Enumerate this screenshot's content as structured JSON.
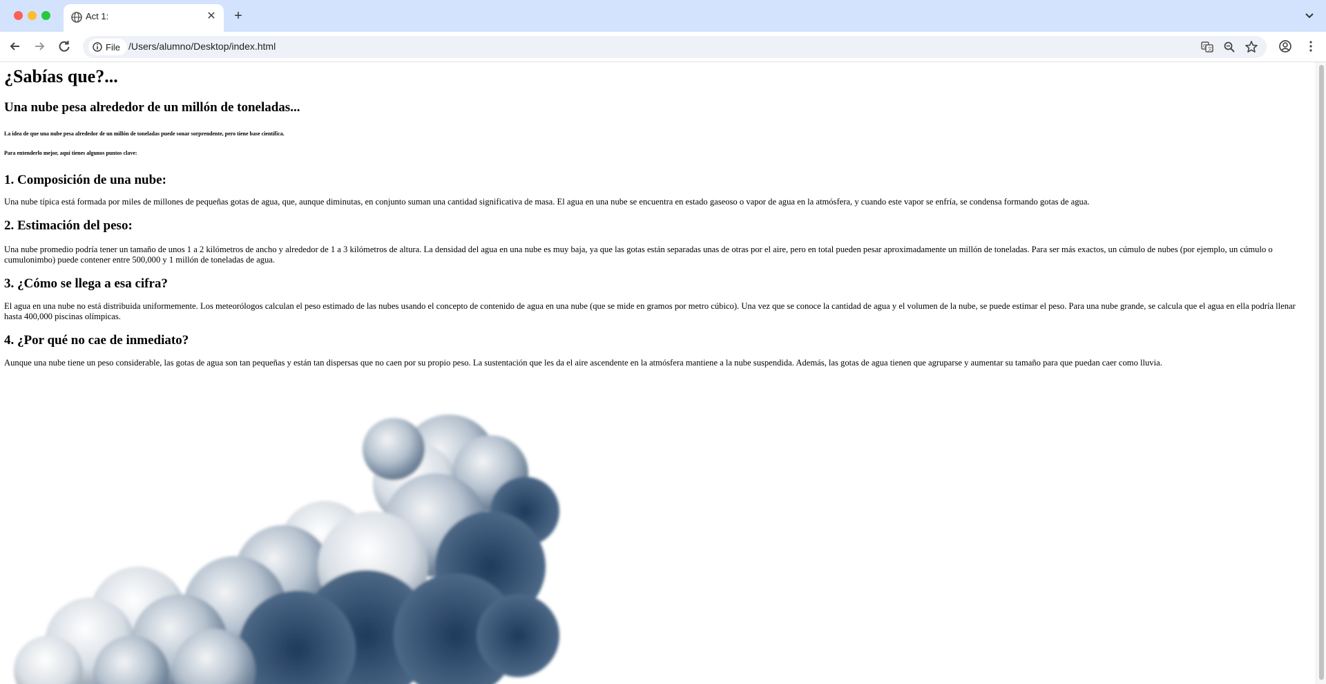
{
  "browser": {
    "tab_title": "Act 1:",
    "tab_close": "✕",
    "new_tab": "+",
    "address_chip": "File",
    "url": "/Users/alumno/Desktop/index.html"
  },
  "page": {
    "title": "¿Sabías que?...",
    "subtitle": "Una nube pesa alrededor de un millón de toneladas...",
    "intro1": "La idea de que una nube pesa alrededor de un millón de toneladas puede sonar sorprendente, pero tiene base científica.",
    "intro2": "Para entenderlo mejor, aquí tienes algunos puntos clave:",
    "sections": [
      {
        "heading": "1. Composición de una nube:",
        "text": "Una nube típica está formada por miles de millones de pequeñas gotas de agua, que, aunque diminutas, en conjunto suman una cantidad significativa de masa. El agua en una nube se encuentra en estado gaseoso o vapor de agua en la atmósfera, y cuando este vapor se enfría, se condensa formando gotas de agua."
      },
      {
        "heading": "2. Estimación del peso:",
        "text": "Una nube promedio podría tener un tamaño de unos 1 a 2 kilómetros de ancho y alrededor de 1 a 3 kilómetros de altura. La densidad del agua en una nube es muy baja, ya que las gotas están separadas unas de otras por el aire, pero en total pueden pesar aproximadamente un millón de toneladas. Para ser más exactos, un cúmulo de nubes (por ejemplo, un cúmulo o cumulonimbo) puede contener entre 500,000 y 1 millón de toneladas de agua."
      },
      {
        "heading": "3. ¿Cómo se llega a esa cifra?",
        "text": "El agua en una nube no está distribuida uniformemente. Los meteorólogos calculan el peso estimado de las nubes usando el concepto de contenido de agua en una nube (que se mide en gramos por metro cúbico). Una vez que se conoce la cantidad de agua y el volumen de la nube, se puede estimar el peso. Para una nube grande, se calcula que el agua en ella podría llenar hasta 400,000 piscinas olímpicas."
      },
      {
        "heading": "4. ¿Por qué no cae de inmediato?",
        "text": "Aunque una nube tiene un peso considerable, las gotas de agua son tan pequeñas y están tan dispersas que no caen por su propio peso. La sustentación que les da el aire ascendente en la atmósfera mantiene a la nube suspendida. Además, las gotas de agua tienen que agruparse y aumentar su tamaño para que puedan caer como lluvia."
      }
    ]
  },
  "colors": {
    "tabbar_bg": "#d3e3fd",
    "omnibox_bg": "#eef1f8",
    "cloud_dark": "#2e4a6e",
    "cloud_light": "#e7ebf0"
  },
  "icons": [
    "globe-icon",
    "close-icon",
    "plus-icon",
    "chevron-down-icon",
    "back-arrow-icon",
    "forward-arrow-icon",
    "reload-icon",
    "info-icon",
    "translate-icon",
    "zoom-icon",
    "star-icon",
    "profile-icon",
    "kebab-menu-icon"
  ]
}
